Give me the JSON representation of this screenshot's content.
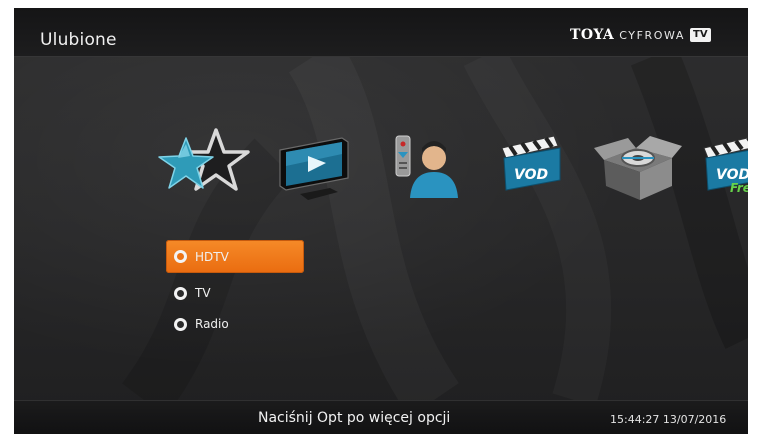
{
  "header": {
    "title": "Ulubione",
    "brand": {
      "name": "TOYA",
      "suffix": "CYFROWA",
      "badge": "TV"
    }
  },
  "categories": [
    {
      "name": "favorites",
      "icon": "star-icon",
      "label": ""
    },
    {
      "name": "tv",
      "icon": "tv-play-icon",
      "label": ""
    },
    {
      "name": "user",
      "icon": "user-remote-icon",
      "label": ""
    },
    {
      "name": "vod",
      "icon": "clapperboard-icon",
      "label": "VOD"
    },
    {
      "name": "archive",
      "icon": "box-film-icon",
      "label": ""
    },
    {
      "name": "vod-free",
      "icon": "clapperboard-free-icon",
      "label": "VOD",
      "badge": "Free"
    }
  ],
  "menu": {
    "items": [
      {
        "label": "HDTV",
        "selected": true
      },
      {
        "label": "TV",
        "selected": false
      },
      {
        "label": "Radio",
        "selected": false
      }
    ]
  },
  "footer": {
    "hint": "Naciśnij Opt po więcej opcji",
    "clock": "15:44:27 13/07/2016"
  },
  "colors": {
    "accent": "#ec7415",
    "background": "#2a2a2b",
    "bar": "#151516",
    "star": "#2f9bb8"
  }
}
